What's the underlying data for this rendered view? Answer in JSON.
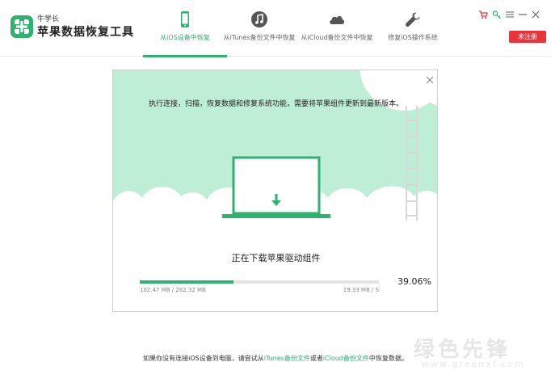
{
  "app": {
    "brand_small": "牛学长",
    "brand_name": "苹果数据恢复工具",
    "register_label": "未注册"
  },
  "colors": {
    "accent": "#2fb26f",
    "mint_background": "#bfeed7",
    "register_red": "#e8343b"
  },
  "tabs": [
    {
      "label": "从iOS设备中恢复",
      "icon": "phone-icon",
      "active": true
    },
    {
      "label": "从iTunes备份文件中恢复",
      "icon": "music-icon",
      "active": false
    },
    {
      "label": "从iCloud备份文件中恢复",
      "icon": "cloud-icon",
      "active": false
    },
    {
      "label": "修复iOS操作系统",
      "icon": "wrench-icon",
      "active": false
    }
  ],
  "window_controls": [
    "cart-icon",
    "key-icon",
    "menu-icon",
    "minimize-icon",
    "close-icon"
  ],
  "dialog": {
    "notice": "执行连接，扫描，恢复数据和修复系统功能，需要将苹果组件更新到最新版本。",
    "status": "正在下载苹果驱动组件",
    "downloaded": "102.47 MB / 262.32 MB",
    "speed": "19.33 MB / S",
    "percent_label": "39.06%",
    "progress": 0.3906
  },
  "footer": {
    "prefix": "如果你没有连接iOS设备到电脑，请尝试从",
    "link_itunes": "iTunes备份文件",
    "middle": "或者",
    "link_icloud": "iCloud备份文件",
    "suffix": "中恢复数据。"
  },
  "watermark": {
    "text": "绿色先锋",
    "url": "www.greenxf.com"
  }
}
